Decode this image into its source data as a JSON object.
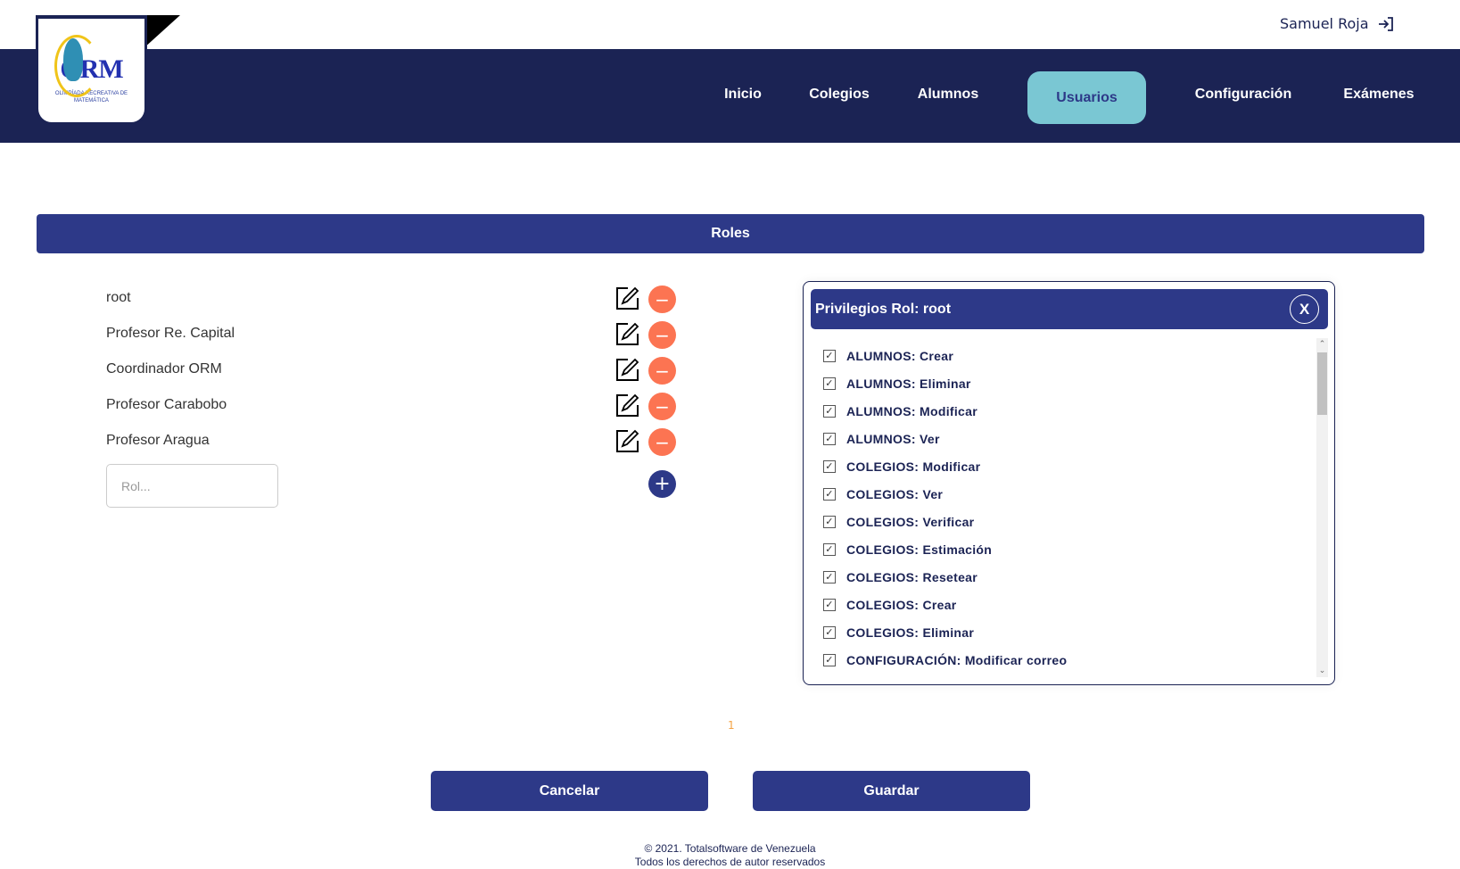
{
  "header": {
    "logo_text": "ORM",
    "logo_subtitle": "OLIMPÍADA RECREATIVA DE MATEMÁTICA",
    "user_name": "Samuel Roja",
    "logout_icon": "logout-icon",
    "nav": [
      {
        "label": "Inicio",
        "active": false
      },
      {
        "label": "Colegios",
        "active": false
      },
      {
        "label": "Alumnos",
        "active": false
      },
      {
        "label": "Usuarios",
        "active": true
      },
      {
        "label": "Configuración",
        "active": false
      },
      {
        "label": "Exámenes",
        "active": false
      }
    ]
  },
  "roles": {
    "title": "Roles",
    "items": [
      "root",
      "Profesor Re. Capital",
      "Coordinador ORM",
      "Profesor Carabobo",
      "Profesor Aragua"
    ],
    "input_placeholder": "Rol...",
    "input_value": ""
  },
  "privileges": {
    "title": "Privilegios Rol:  root",
    "close_label": "X",
    "items": [
      {
        "label": "ALUMNOS: Crear",
        "checked": true
      },
      {
        "label": "ALUMNOS: Eliminar",
        "checked": true
      },
      {
        "label": "ALUMNOS: Modificar",
        "checked": true
      },
      {
        "label": "ALUMNOS: Ver",
        "checked": true
      },
      {
        "label": "COLEGIOS: Modificar",
        "checked": true
      },
      {
        "label": "COLEGIOS: Ver",
        "checked": true
      },
      {
        "label": "COLEGIOS: Verificar",
        "checked": true
      },
      {
        "label": "COLEGIOS: Estimación",
        "checked": true
      },
      {
        "label": "COLEGIOS: Resetear",
        "checked": true
      },
      {
        "label": "COLEGIOS: Crear",
        "checked": true
      },
      {
        "label": "COLEGIOS: Eliminar",
        "checked": true
      },
      {
        "label": "CONFIGURACIÓN: Modificar correo",
        "checked": true
      }
    ]
  },
  "pagination": {
    "current_page": "1"
  },
  "actions": {
    "cancel_label": "Cancelar",
    "save_label": "Guardar"
  },
  "footer": {
    "line1": "© 2021. Totalsoftware de Venezuela",
    "line2": "Todos los derechos de autor reservados"
  },
  "colors": {
    "navy": "#1b2354",
    "primary": "#2d3988",
    "active_tab": "#7ac7d3",
    "delete": "#fc7452",
    "page_number": "#f4a344"
  }
}
